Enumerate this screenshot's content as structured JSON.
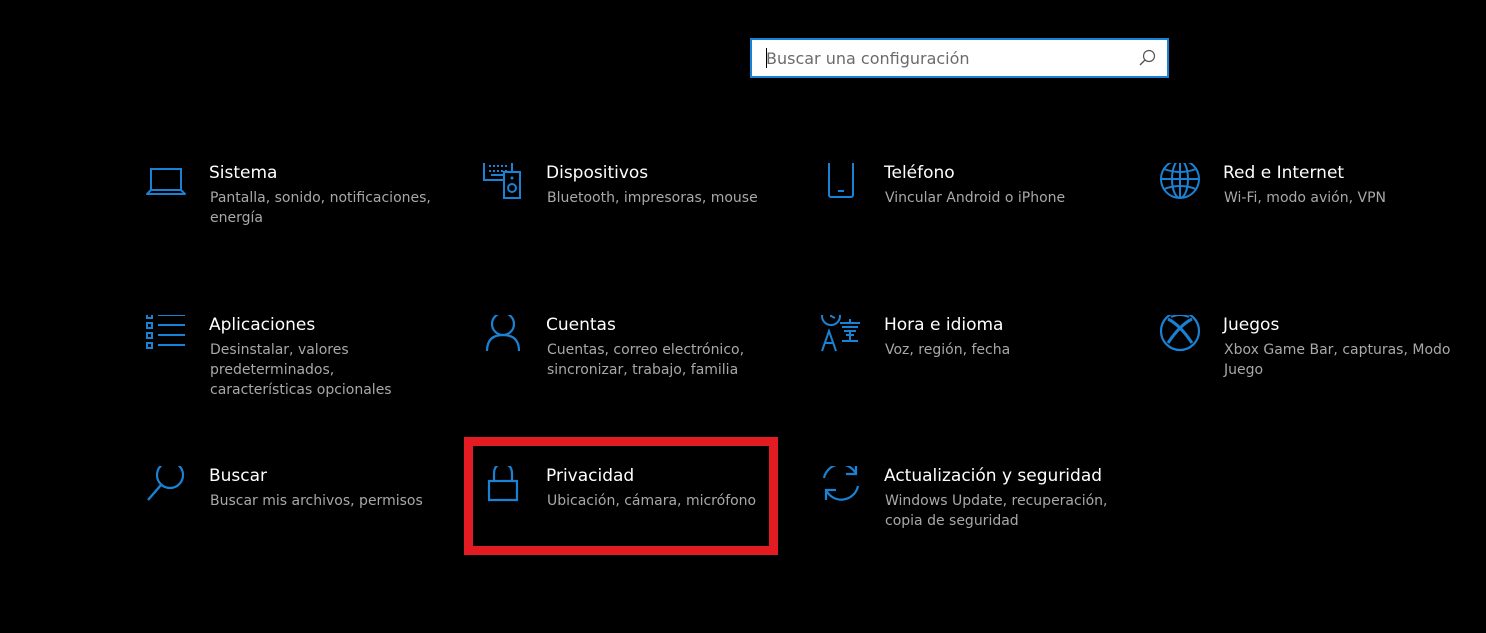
{
  "search": {
    "placeholder": "Buscar una configuración",
    "icon": "search-icon"
  },
  "tiles": [
    {
      "title": "Sistema",
      "desc": "Pantalla, sonido, notificaciones, energía",
      "icon": "laptop-icon"
    },
    {
      "title": "Dispositivos",
      "desc": "Bluetooth, impresoras, mouse",
      "icon": "devices-icon"
    },
    {
      "title": "Teléfono",
      "desc": "Vincular Android o iPhone",
      "icon": "phone-icon"
    },
    {
      "title": "Red e Internet",
      "desc": "Wi-Fi, modo avión, VPN",
      "icon": "globe-icon"
    },
    {
      "title": "Aplicaciones",
      "desc": "Desinstalar, valores predeterminados, características opcionales",
      "icon": "apps-list-icon"
    },
    {
      "title": "Cuentas",
      "desc": "Cuentas, correo electrónico, sincronizar, trabajo, familia",
      "icon": "person-icon"
    },
    {
      "title": "Hora e idioma",
      "desc": "Voz, región, fecha",
      "icon": "time-language-icon"
    },
    {
      "title": "Juegos",
      "desc": "Xbox Game Bar, capturas, Modo Juego",
      "icon": "xbox-icon"
    },
    {
      "title": "Buscar",
      "desc": "Buscar mis archivos, permisos",
      "icon": "magnifier-icon"
    },
    {
      "title": "Privacidad",
      "desc": "Ubicación, cámara, micrófono",
      "icon": "lock-icon"
    },
    {
      "title": "Actualización y seguridad",
      "desc": "Windows Update, recuperación, copia de seguridad",
      "icon": "sync-icon"
    }
  ],
  "colors": {
    "background": "#000000",
    "accent": "#1a82d4",
    "title_text": "#ffffff",
    "desc_text": "#a8a8a8",
    "highlight": "#e31b23"
  },
  "highlight": {
    "target": "Privacidad"
  }
}
